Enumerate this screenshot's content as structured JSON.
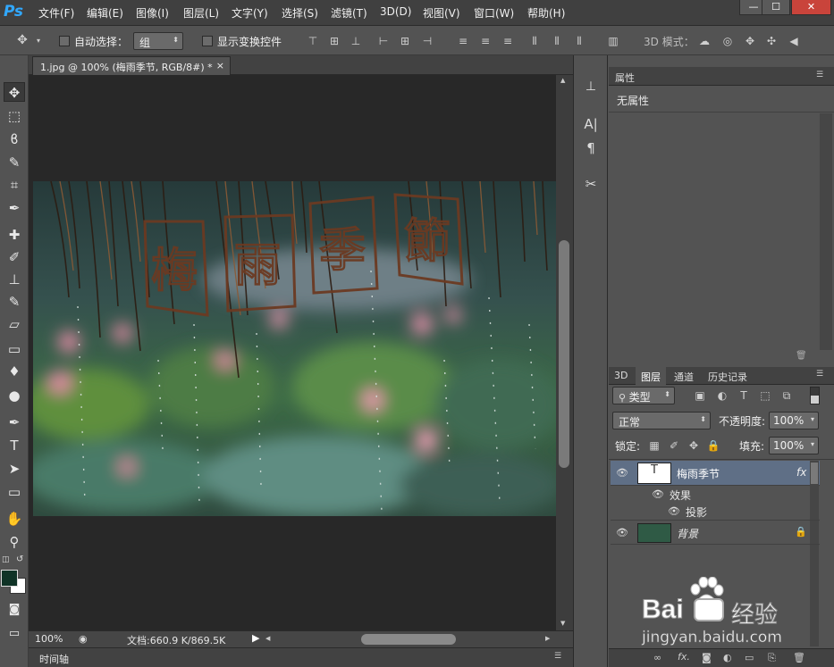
{
  "menubar": {
    "logo": "Ps",
    "items": [
      "文件(F)",
      "编辑(E)",
      "图像(I)",
      "图层(L)",
      "文字(Y)",
      "选择(S)",
      "滤镜(T)",
      "3D(D)",
      "视图(V)",
      "窗口(W)",
      "帮助(H)"
    ],
    "window_buttons": [
      "—",
      "☐",
      "✕"
    ]
  },
  "options": {
    "auto_select_label": "自动选择：",
    "auto_select_value": "组",
    "show_transform_label": "显示变换控件",
    "mode_3d_label": "3D 模式："
  },
  "document": {
    "tab_title": "1.jpg @ 100% (梅雨季节, RGB/8#) *",
    "tab_close": "×",
    "title_glyphs": [
      "梅",
      "雨",
      "季",
      "節"
    ]
  },
  "statusbar": {
    "zoom": "100%",
    "doc_info": "文档:660.9 K/869.5K"
  },
  "timeline": {
    "label": "时间轴"
  },
  "properties": {
    "tab": "属性",
    "content": "无属性"
  },
  "layers_panel": {
    "tabs": [
      "3D",
      "图层",
      "通道",
      "历史记录"
    ],
    "filter_label": "类型",
    "blend_mode": "正常",
    "opacity_label": "不透明度:",
    "opacity_value": "100%",
    "lock_label": "锁定:",
    "fill_label": "填充:",
    "fill_value": "100%",
    "layers": [
      {
        "name": "梅雨季节",
        "fx": "fx"
      },
      {
        "name": "效果"
      },
      {
        "name": "投影"
      },
      {
        "name": "背景"
      }
    ]
  },
  "watermark": {
    "brand": "Bai",
    "brand_suffix": "经验",
    "url": "jingyan.baidu.com"
  },
  "colors": {
    "accent": "#31a8ff",
    "foreground_swatch": "#0f3326",
    "selected_layer": "#5f6f86"
  }
}
